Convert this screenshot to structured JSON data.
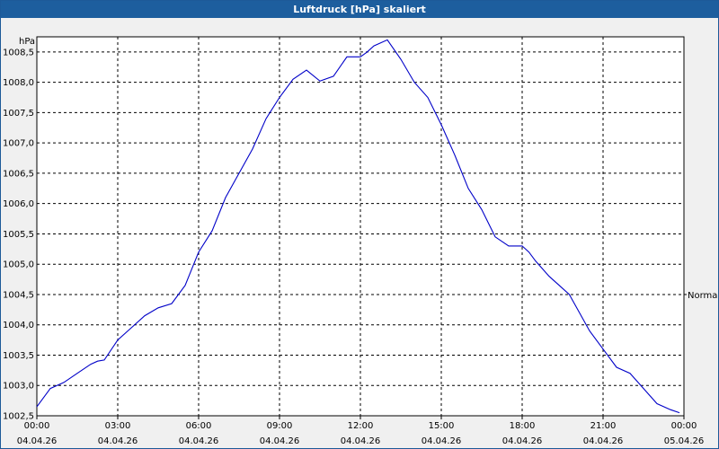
{
  "window": {
    "title": "Luftdruck [hPa] skaliert"
  },
  "colors": {
    "titlebar": "#1d5e9e",
    "series": "#0000c8",
    "background": "#f0f0f0"
  },
  "chart_data": {
    "type": "line",
    "title": "Luftdruck [hPa] skaliert",
    "ylabel": "hPa",
    "xlabel": "",
    "ylim": [
      1002.5,
      1008.75
    ],
    "xlim": [
      "2026-04-04 00:00",
      "2026-04-05 00:00"
    ],
    "y_ticks": [
      "1002,5",
      "1003,0",
      "1003,5",
      "1004,0",
      "1004,5",
      "1005,0",
      "1005,5",
      "1006,0",
      "1006,5",
      "1007,0",
      "1007,5",
      "1008,0",
      "1008,5"
    ],
    "x_ticks": [
      {
        "time": "00:00",
        "date": "04.04.26"
      },
      {
        "time": "03:00",
        "date": "04.04.26"
      },
      {
        "time": "06:00",
        "date": "04.04.26"
      },
      {
        "time": "09:00",
        "date": "04.04.26"
      },
      {
        "time": "12:00",
        "date": "04.04.26"
      },
      {
        "time": "15:00",
        "date": "04.04.26"
      },
      {
        "time": "18:00",
        "date": "04.04.26"
      },
      {
        "time": "21:00",
        "date": "04.04.26"
      },
      {
        "time": "00:00",
        "date": "05.04.26"
      }
    ],
    "grid": true,
    "legend_label": "Normal",
    "series": [
      {
        "x": [
          "00:00",
          "00:30",
          "01:00",
          "01:30",
          "02:00",
          "02:15",
          "02:30",
          "03:00",
          "03:30",
          "04:00",
          "04:30",
          "05:00",
          "05:30",
          "06:00",
          "06:30",
          "07:00",
          "07:30",
          "08:00",
          "08:30",
          "09:00",
          "09:30",
          "10:00",
          "10:30",
          "11:00",
          "11:30",
          "12:00",
          "12:15",
          "12:30",
          "13:00",
          "13:30",
          "14:00",
          "14:30",
          "15:00",
          "15:30",
          "16:00",
          "16:30",
          "17:00",
          "17:30",
          "18:00",
          "18:15",
          "18:30",
          "19:00",
          "19:30",
          "19:45",
          "20:00",
          "20:30",
          "21:00",
          "21:30",
          "22:00",
          "22:30",
          "23:00",
          "23:30",
          "23:50"
        ],
        "values": [
          1002.65,
          1002.95,
          1003.05,
          1003.2,
          1003.35,
          1003.4,
          1003.42,
          1003.75,
          1003.95,
          1004.15,
          1004.28,
          1004.35,
          1004.65,
          1005.2,
          1005.55,
          1006.1,
          1006.5,
          1006.9,
          1007.4,
          1007.75,
          1008.05,
          1008.2,
          1008.02,
          1008.1,
          1008.42,
          1008.42,
          1008.5,
          1008.6,
          1008.7,
          1008.38,
          1008.0,
          1007.75,
          1007.3,
          1006.8,
          1006.25,
          1005.9,
          1005.45,
          1005.3,
          1005.3,
          1005.2,
          1005.05,
          1004.8,
          1004.6,
          1004.5,
          1004.3,
          1003.9,
          1003.6,
          1003.3,
          1003.2,
          1002.95,
          1002.7,
          1002.6,
          1002.55
        ]
      }
    ]
  }
}
